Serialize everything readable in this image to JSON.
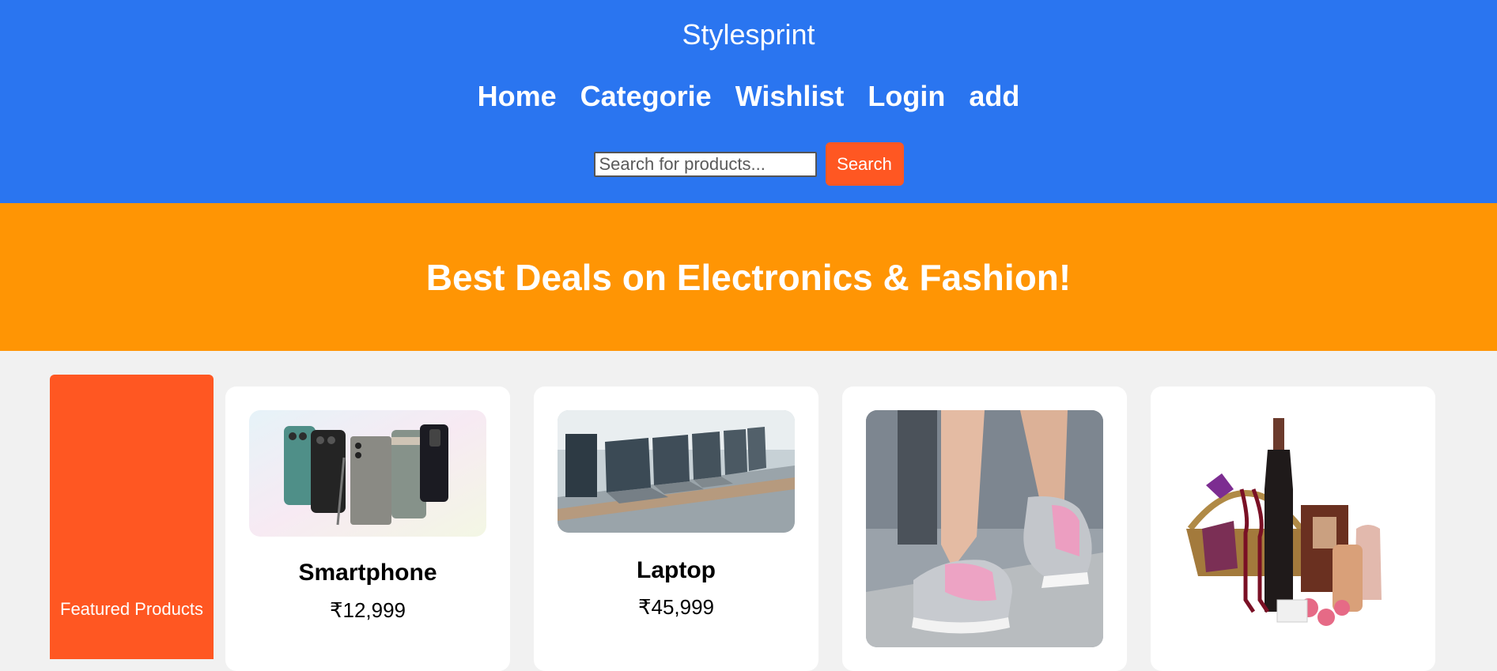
{
  "header": {
    "brand": "Stylesprint",
    "nav": [
      "Home",
      "Categorie",
      "Wishlist",
      "Login",
      "add"
    ],
    "search": {
      "placeholder": "Search for products...",
      "value": "",
      "button_label": "Search"
    },
    "colors": {
      "background": "#2a75f0",
      "search_button": "#ff5722"
    }
  },
  "banner": {
    "text": "Best Deals on Electronics & Fashion!",
    "color": "#ff9504"
  },
  "featured": {
    "label": "Featured Products",
    "color": "#ff5722"
  },
  "products": [
    {
      "name": "Smartphone",
      "price": "₹12,999",
      "image": "smartphones-image"
    },
    {
      "name": "Laptop",
      "price": "₹45,999",
      "image": "laptops-image"
    },
    {
      "name": "",
      "price": "",
      "image": "sneakers-image"
    },
    {
      "name": "",
      "price": "",
      "image": "gift-basket-image"
    }
  ]
}
